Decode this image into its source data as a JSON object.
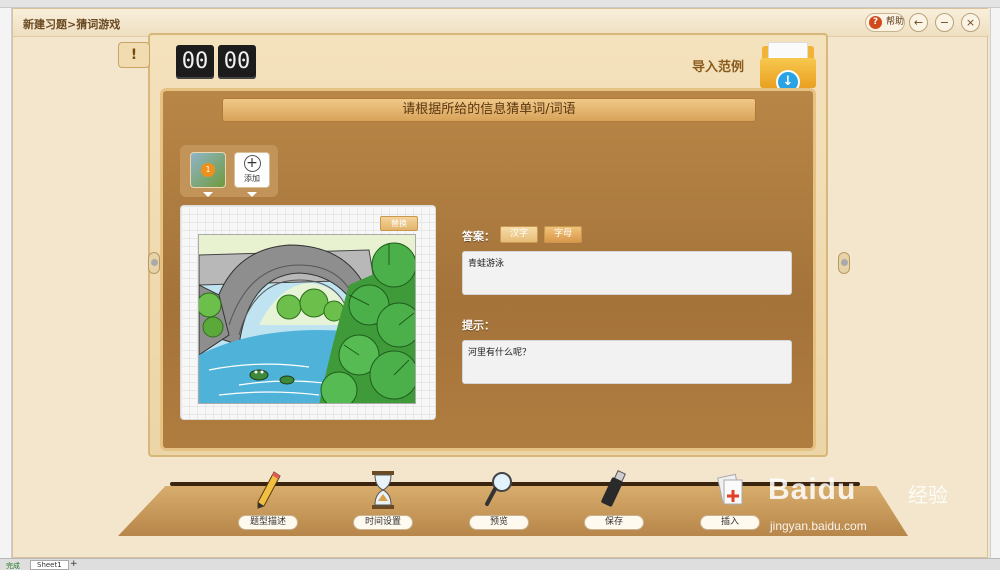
{
  "window": {
    "title": "新建习题>猜词游戏",
    "help_label": "帮助"
  },
  "timer": {
    "minutes": "00",
    "seconds": "00"
  },
  "import": {
    "label": "导入范例"
  },
  "prompt": {
    "banner": "请根据所给的信息猜单词/词语"
  },
  "thumbnails": [
    {
      "number": "1"
    }
  ],
  "add_button": {
    "label": "添加"
  },
  "image_card": {
    "replace_label": "替换"
  },
  "answer": {
    "label": "答案：",
    "tab_hanzi": "汉字",
    "tab_zimu": "字母",
    "value": "青蛙游泳"
  },
  "hint": {
    "label": "提示：",
    "value": "河里有什么呢？"
  },
  "toolbar": [
    {
      "label": "题型描述",
      "icon": "pencil-icon"
    },
    {
      "label": "时间设置",
      "icon": "hourglass-icon"
    },
    {
      "label": "预览",
      "icon": "magnifier-icon"
    },
    {
      "label": "保存",
      "icon": "usb-drive-icon"
    },
    {
      "label": "插入",
      "icon": "insert-icon"
    }
  ],
  "watermark": {
    "brand": "Baidu",
    "suffix": "经验",
    "url": "jingyan.baidu.com"
  },
  "spreadsheet": {
    "status": "完成",
    "sheet_tab": "Sheet1",
    "add_sheet": "+"
  },
  "colors": {
    "accent": "#d7b77a",
    "board_inner": "#a4733a",
    "timer_bg": "#1c1c1c",
    "folder": "#f2b436",
    "download": "#2aa3e4",
    "help_icon": "#d04a1a"
  }
}
